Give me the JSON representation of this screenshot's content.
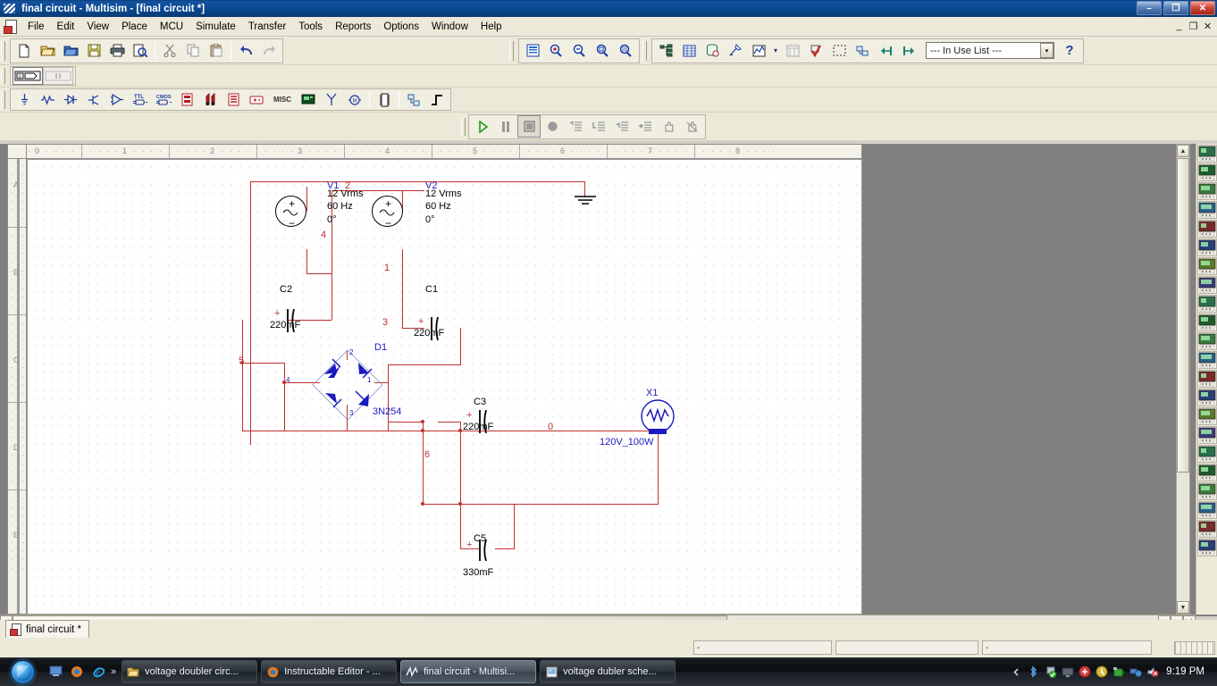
{
  "window": {
    "title": "final circuit - Multisim - [final circuit *]",
    "icon": "multisim-icon",
    "minimize": "–",
    "maximize": "❐",
    "close": "✕",
    "mdi_minimize": "_",
    "mdi_restore": "❐",
    "mdi_close": "✕"
  },
  "menu": {
    "items": [
      {
        "label": "File"
      },
      {
        "label": "Edit"
      },
      {
        "label": "View"
      },
      {
        "label": "Place"
      },
      {
        "label": "MCU"
      },
      {
        "label": "Simulate"
      },
      {
        "label": "Transfer"
      },
      {
        "label": "Tools"
      },
      {
        "label": "Reports"
      },
      {
        "label": "Options"
      },
      {
        "label": "Window"
      },
      {
        "label": "Help"
      }
    ]
  },
  "toolbars": {
    "standard": [
      {
        "name": "new-file-icon",
        "glyph": "⬜"
      },
      {
        "name": "open-file-icon",
        "glyph": "📂"
      },
      {
        "name": "open-design-icon",
        "glyph": "📁"
      },
      {
        "name": "save-icon",
        "glyph": "💾"
      },
      {
        "name": "print-icon",
        "glyph": "⎙"
      },
      {
        "name": "print-preview-icon",
        "glyph": "🔍"
      },
      {
        "name": "cut-icon",
        "glyph": "✂"
      },
      {
        "name": "copy-icon",
        "glyph": "⧉"
      },
      {
        "name": "paste-icon",
        "glyph": "📋"
      },
      {
        "name": "undo-icon",
        "glyph": "↶"
      },
      {
        "name": "redo-icon",
        "glyph": "↷"
      }
    ],
    "view": [
      {
        "name": "toggle-full-screen-icon",
        "glyph": "▤"
      },
      {
        "name": "zoom-in-icon",
        "glyph": "🔍"
      },
      {
        "name": "zoom-out-icon",
        "glyph": "🔎"
      },
      {
        "name": "zoom-area-icon",
        "glyph": "🔍"
      },
      {
        "name": "zoom-fit-icon",
        "glyph": "🔍"
      }
    ],
    "design": [
      {
        "name": "design-toolbox-icon",
        "glyph": "⛓"
      },
      {
        "name": "spreadsheet-view-icon",
        "glyph": "▦"
      },
      {
        "name": "database-icon",
        "glyph": "⛁"
      },
      {
        "name": "component-wizard-icon",
        "glyph": "◢"
      },
      {
        "name": "grapher-icon",
        "glyph": "📈"
      },
      {
        "name": "grapher-dropdown-icon",
        "glyph": "▾"
      },
      {
        "name": "postprocessor-icon",
        "glyph": "▧"
      },
      {
        "name": "electrical-rules-check-icon",
        "glyph": "✔"
      },
      {
        "name": "area-capture-icon",
        "glyph": "⬚"
      },
      {
        "name": "back-annotate-icon",
        "glyph": "⧉"
      },
      {
        "name": "transfer-to-ultiboard-icon",
        "glyph": "⇤"
      },
      {
        "name": "forward-annotate-icon",
        "glyph": "⇥"
      }
    ],
    "in_use_list": {
      "label": "--- In Use List ---",
      "dropdown_arrow": "▾"
    },
    "help_button": "?",
    "probe_row": [
      {
        "name": "measurement-probe-icon",
        "glyph": "▣"
      },
      {
        "name": "current-probe-icon",
        "glyph": "‖"
      }
    ],
    "components": [
      {
        "name": "place-source-icon",
        "glyph": "⊕"
      },
      {
        "name": "place-basic-icon",
        "glyph": "〰"
      },
      {
        "name": "place-diode-icon",
        "glyph": "▷❘"
      },
      {
        "name": "place-transistor-icon",
        "glyph": "⎇"
      },
      {
        "name": "place-analog-icon",
        "glyph": "▷"
      },
      {
        "name": "place-ttl-icon",
        "glyph": "TTL"
      },
      {
        "name": "place-cmos-icon",
        "glyph": "CMOS"
      },
      {
        "name": "place-misc-digital-icon",
        "glyph": "◫"
      },
      {
        "name": "place-mixed-icon",
        "glyph": "❁"
      },
      {
        "name": "place-indicator-icon",
        "glyph": "▤"
      },
      {
        "name": "place-power-icon",
        "glyph": "▭"
      },
      {
        "name": "place-misc-icon",
        "glyph": "MISC"
      },
      {
        "name": "place-advanced-peripherals-icon",
        "glyph": "▰"
      },
      {
        "name": "place-rf-icon",
        "glyph": "Ψ"
      },
      {
        "name": "place-electromechanical-icon",
        "glyph": "Ⓜ"
      },
      {
        "name": "place-mcu-icon",
        "glyph": "⌸"
      },
      {
        "name": "place-hierarchical-block-icon",
        "glyph": "⬚"
      },
      {
        "name": "place-bus-icon",
        "glyph": "┑"
      }
    ]
  },
  "simulation_toolbar": {
    "buttons": [
      {
        "name": "run-simulation-button",
        "glyph": "▶",
        "state": "enabled"
      },
      {
        "name": "pause-simulation-button",
        "glyph": "‖",
        "state": "disabled"
      },
      {
        "name": "stop-simulation-button",
        "glyph": "■",
        "state": "pressed"
      },
      {
        "name": "record-button",
        "glyph": "●",
        "state": "disabled"
      },
      {
        "name": "step-into-button",
        "glyph": "↰",
        "state": "disabled"
      },
      {
        "name": "step-over-button",
        "glyph": "↳",
        "state": "disabled"
      },
      {
        "name": "step-out-button",
        "glyph": "↱",
        "state": "disabled"
      },
      {
        "name": "run-to-cursor-button",
        "glyph": "→",
        "state": "disabled"
      },
      {
        "name": "pause-at-next-button",
        "glyph": "✋",
        "state": "disabled"
      },
      {
        "name": "toggle-breakpoint-button",
        "glyph": "✋",
        "state": "disabled"
      }
    ]
  },
  "instruments_panel": [
    {
      "name": "multimeter-instrument",
      "glyph": "▤"
    },
    {
      "name": "function-generator-instrument",
      "glyph": "∿"
    },
    {
      "name": "wattmeter-instrument",
      "glyph": "▦"
    },
    {
      "name": "oscilloscope-instrument",
      "glyph": "▭"
    },
    {
      "name": "four-channel-oscilloscope-instrument",
      "glyph": "☷"
    },
    {
      "name": "bode-plotter-instrument",
      "glyph": "123"
    },
    {
      "name": "frequency-counter-instrument",
      "glyph": "AG"
    },
    {
      "name": "word-generator-instrument",
      "glyph": "░"
    },
    {
      "name": "logic-converter-instrument",
      "glyph": "▒"
    },
    {
      "name": "logic-analyzer-instrument",
      "glyph": "▓"
    },
    {
      "name": "iv-analyzer-instrument",
      "glyph": "░"
    },
    {
      "name": "distortion-analyzer-instrument",
      "glyph": "▧"
    },
    {
      "name": "spectrum-analyzer-instrument",
      "glyph": "▒"
    },
    {
      "name": "network-analyzer-instrument",
      "glyph": "AG"
    },
    {
      "name": "agilent-function-generator-instrument",
      "glyph": "AG"
    },
    {
      "name": "agilent-multimeter-instrument",
      "glyph": "▄"
    },
    {
      "name": "agilent-oscilloscope-instrument",
      "glyph": "▓"
    },
    {
      "name": "tektronix-oscilloscope-instrument",
      "glyph": "░"
    },
    {
      "name": "current-clamp-instrument",
      "glyph": "◖"
    },
    {
      "name": "labview-instruments-icon",
      "glyph": "⬚"
    },
    {
      "name": "measurement-probe-icon",
      "glyph": "▸"
    },
    {
      "name": "dynamic-probe-icon",
      "glyph": "◢"
    }
  ],
  "ruler": {
    "horizontal": [
      "0",
      "1",
      "2",
      "3",
      "4",
      "5",
      "6",
      "7",
      "8"
    ],
    "vertical": [
      "A",
      "B",
      "C",
      "D",
      "E"
    ]
  },
  "document_tab": {
    "label": "final circuit *",
    "icon": "schematic-document-icon"
  },
  "status_bar": {
    "panel1": "-",
    "panel2": "",
    "panel3": "-"
  },
  "taskbar": {
    "start_button": "start-orb",
    "quick_launch": [
      {
        "name": "show-desktop-icon",
        "glyph": "▣"
      },
      {
        "name": "firefox-icon",
        "glyph": "●"
      },
      {
        "name": "internet-explorer-icon",
        "glyph": "e"
      }
    ],
    "chevron": "»",
    "tasks": [
      {
        "name": "taskbar-item-voltage-doubler-circ",
        "label": "voltage doubler circ...",
        "icon": "folder-icon",
        "active": false
      },
      {
        "name": "taskbar-item-instructable-editor",
        "label": "Instructable Editor - ...",
        "icon": "firefox-icon",
        "active": false
      },
      {
        "name": "taskbar-item-final-circuit-multisim",
        "label": "final circuit - Multisi...",
        "icon": "multisim-icon",
        "active": true
      },
      {
        "name": "taskbar-item-voltage-dubler-sche",
        "label": "voltage dubler sche...",
        "icon": "image-icon",
        "active": false
      }
    ],
    "tray": [
      {
        "name": "tray-expand-icon",
        "glyph": "◀"
      },
      {
        "name": "bluetooth-icon",
        "glyph": "ᛗ"
      },
      {
        "name": "safely-remove-hardware-icon",
        "glyph": "✔"
      },
      {
        "name": "display-icon",
        "glyph": "▭"
      },
      {
        "name": "antivirus-icon",
        "glyph": "●"
      },
      {
        "name": "update-icon",
        "glyph": "⚙"
      },
      {
        "name": "battery-icon",
        "glyph": "▯"
      },
      {
        "name": "network-icon",
        "glyph": "▤"
      },
      {
        "name": "volume-icon",
        "glyph": "🔈"
      }
    ],
    "clock": "9:19 PM"
  },
  "schematic": {
    "title": "final circuit",
    "components": [
      {
        "ref": "V1",
        "type": "ac-voltage-source",
        "value_lines": [
          "12 Vrms",
          "60 Hz",
          "0°"
        ]
      },
      {
        "ref": "V2",
        "type": "ac-voltage-source",
        "value_lines": [
          "12 Vrms",
          "60 Hz",
          "0°"
        ]
      },
      {
        "ref": "C1",
        "type": "polarized-capacitor",
        "value": "220mF"
      },
      {
        "ref": "C2",
        "type": "polarized-capacitor",
        "value": "220mF"
      },
      {
        "ref": "C3",
        "type": "polarized-capacitor",
        "value": "220mF"
      },
      {
        "ref": "C5",
        "type": "polarized-capacitor",
        "value": "330mF"
      },
      {
        "ref": "D1",
        "type": "diode-bridge-rectifier",
        "value": "3N254",
        "pins": [
          "1",
          "2",
          "3",
          "4"
        ]
      },
      {
        "ref": "X1",
        "type": "lamp",
        "value": "120V_100W"
      },
      {
        "ref": "GND",
        "type": "ground",
        "value": ""
      }
    ],
    "net_labels": [
      "0",
      "1",
      "2",
      "3",
      "4",
      "5",
      "6"
    ],
    "colors": {
      "wire": "#c03030",
      "component": "#000000",
      "reference": "#2020c0",
      "net_label": "#c03030"
    }
  }
}
